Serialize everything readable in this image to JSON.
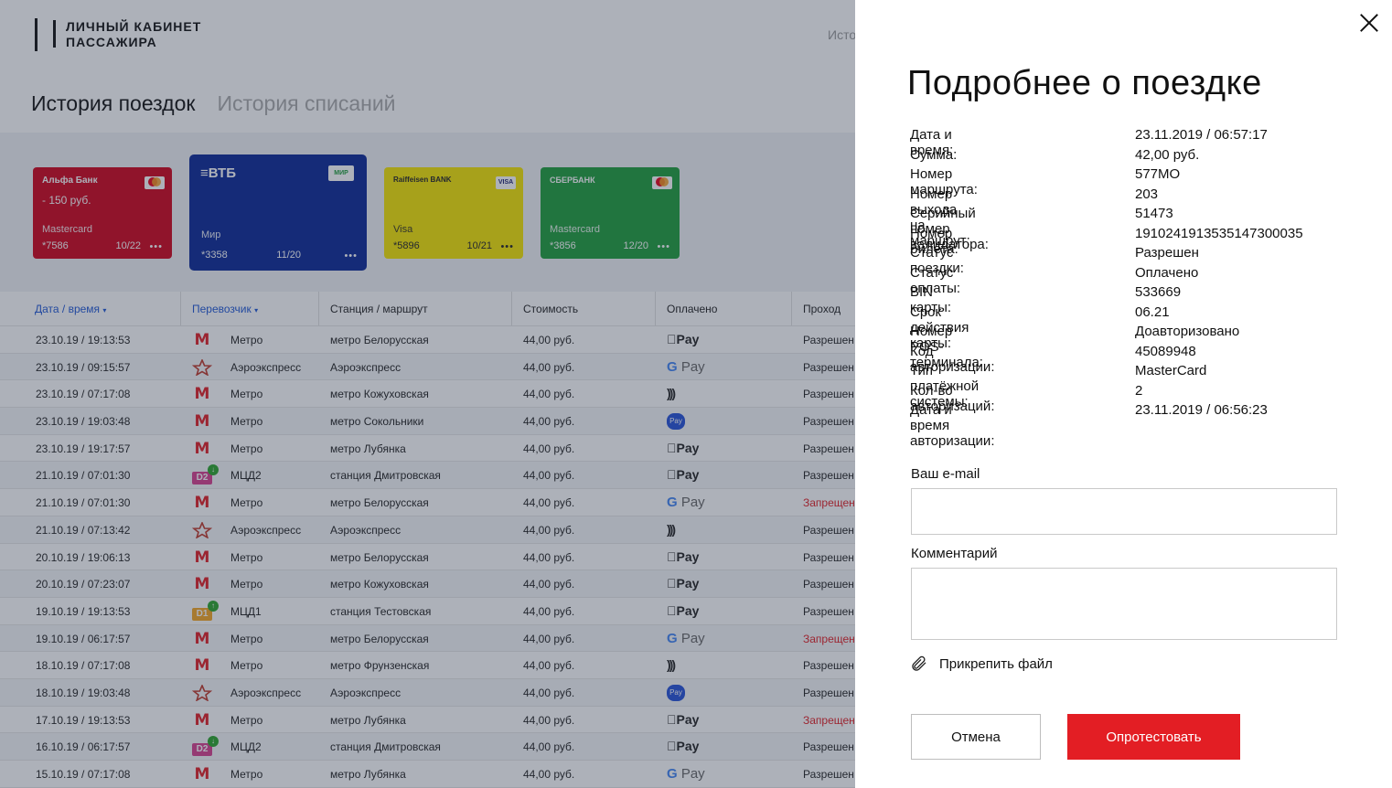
{
  "app": {
    "logo_line1": "ЛИЧНЫЙ КАБИНЕТ",
    "logo_line2": "ПАССАЖИРА",
    "nav_partial": "Исто"
  },
  "page_tabs": [
    {
      "label": "История поездок",
      "active": true
    },
    {
      "label": "История списаний",
      "active": false
    }
  ],
  "cards": [
    {
      "bank": "Альфа Банк",
      "badge": "MC",
      "amount": "- 150 руб.",
      "type": "Mastercard",
      "number": "*7586",
      "expiry": "10/22",
      "color": "#d0021b"
    },
    {
      "bank": "ВТБ",
      "badge": "МИР",
      "amount": "",
      "type": "Мир",
      "number": "*3358",
      "expiry": "11/20",
      "color": "#0a2896"
    },
    {
      "bank": "Raiffeisen BANK",
      "badge": "VISA",
      "amount": "",
      "type": "Visa",
      "number": "*5896",
      "expiry": "10/21",
      "color": "#f6e600"
    },
    {
      "bank": "СБЕРБАНК",
      "badge": "MC",
      "amount": "",
      "type": "Mastercard",
      "number": "*3856",
      "expiry": "12/20",
      "color": "#1e9e3a"
    }
  ],
  "table": {
    "headers": [
      "Дата / время",
      "Перевозчик",
      "Станция / маршрут",
      "Стоимость",
      "Оплачено",
      "Проход"
    ],
    "rows": [
      {
        "date": "23.10.19 / 19:13:53",
        "icon": "M",
        "carrier": "Метро",
        "station": "метро Белорусская",
        "price": "44,00 руб.",
        "paid": "Apple Pay",
        "pass": "Разрешен"
      },
      {
        "date": "23.10.19 / 09:15:57",
        "icon": "AE",
        "carrier": "Аэроэкспресс",
        "station": "Аэроэкспресс",
        "price": "44,00 руб.",
        "paid": "G Pay",
        "pass": "Разрешен"
      },
      {
        "date": "23.10.19 / 07:17:08",
        "icon": "M",
        "carrier": "Метро",
        "station": "метро Кожуховская",
        "price": "44,00 руб.",
        "paid": "contactless",
        "pass": "Разрешен"
      },
      {
        "date": "23.10.19 / 19:03:48",
        "icon": "M",
        "carrier": "Метро",
        "station": "метро Сокольники",
        "price": "44,00 руб.",
        "paid": "Pay",
        "pass": "Разрешен"
      },
      {
        "date": "23.10.19 / 19:17:57",
        "icon": "M",
        "carrier": "Метро",
        "station": "метро Лубянка",
        "price": "44,00 руб.",
        "paid": "Apple Pay",
        "pass": "Разрешен"
      },
      {
        "date": "21.10.19 / 07:01:30",
        "icon": "D2",
        "carrier": "МЦД2",
        "station": "станция Дмитровская",
        "price": "44,00 руб.",
        "paid": "Apple Pay",
        "pass": "Разрешен"
      },
      {
        "date": "21.10.19 / 07:01:30",
        "icon": "M",
        "carrier": "Метро",
        "station": "метро Белорусская",
        "price": "44,00 руб.",
        "paid": "G Pay",
        "pass": "Запрещен"
      },
      {
        "date": "21.10.19 / 07:13:42",
        "icon": "AE",
        "carrier": "Аэроэкспресс",
        "station": "Аэроэкспресс",
        "price": "44,00 руб.",
        "paid": "contactless",
        "pass": "Разрешен"
      },
      {
        "date": "20.10.19 / 19:06:13",
        "icon": "M",
        "carrier": "Метро",
        "station": "метро Белорусская",
        "price": "44,00 руб.",
        "paid": "Apple Pay",
        "pass": "Разрешен"
      },
      {
        "date": "20.10.19 / 07:23:07",
        "icon": "M",
        "carrier": "Метро",
        "station": "метро Кожуховская",
        "price": "44,00 руб.",
        "paid": "Apple Pay",
        "pass": "Разрешен"
      },
      {
        "date": "19.10.19 / 19:13:53",
        "icon": "D1",
        "carrier": "МЦД1",
        "station": "станция Тестовская",
        "price": "44,00 руб.",
        "paid": "Apple Pay",
        "pass": "Разрешен"
      },
      {
        "date": "19.10.19 / 06:17:57",
        "icon": "M",
        "carrier": "Метро",
        "station": "метро Белорусская",
        "price": "44,00 руб.",
        "paid": "G Pay",
        "pass": "Запрещен"
      },
      {
        "date": "18.10.19 / 07:17:08",
        "icon": "M",
        "carrier": "Метро",
        "station": "метро Фрунзенская",
        "price": "44,00 руб.",
        "paid": "contactless",
        "pass": "Разрешен"
      },
      {
        "date": "18.10.19 / 19:03:48",
        "icon": "AE",
        "carrier": "Аэроэкспресс",
        "station": "Аэроэкспресс",
        "price": "44,00 руб.",
        "paid": "Pay",
        "pass": "Разрешен"
      },
      {
        "date": "17.10.19 / 19:13:53",
        "icon": "M",
        "carrier": "Метро",
        "station": "метро Лубянка",
        "price": "44,00 руб.",
        "paid": "Apple Pay",
        "pass": "Запрещен"
      },
      {
        "date": "16.10.19 / 06:17:57",
        "icon": "D2",
        "carrier": "МЦД2",
        "station": "станция Дмитровская",
        "price": "44,00 руб.",
        "paid": "Apple Pay",
        "pass": "Разрешен"
      },
      {
        "date": "15.10.19 / 07:17:08",
        "icon": "M",
        "carrier": "Метро",
        "station": "метро Лубянка",
        "price": "44,00 руб.",
        "paid": "G Pay",
        "pass": "Разрешен"
      }
    ]
  },
  "panel": {
    "title": "Подробнее о поездке",
    "details": [
      {
        "label": "Дата и время:",
        "value": "23.11.2019 / 06:57:17"
      },
      {
        "label": "Сумма:",
        "value": "42,00  руб."
      },
      {
        "label": "Номер маршрута:",
        "value": "577МО"
      },
      {
        "label": "Номер выхода на маршрут:",
        "value": "203"
      },
      {
        "label": "Серийный номер валидатора:",
        "value": "51473"
      },
      {
        "label": "Номер билета:",
        "value": "1910241913535147300035"
      },
      {
        "label": "Статус поездки:",
        "value": "Разрешен"
      },
      {
        "label": "Статус оплаты:",
        "value": "Оплачено"
      },
      {
        "label": "BIN карты:",
        "value": "533669"
      },
      {
        "label": "Срок действия карты:",
        "value": "06.21"
      },
      {
        "label": "Номер POS-терминала:",
        "value": "Доавторизовано"
      },
      {
        "label": "Код авторизации:",
        "value": "45089948"
      },
      {
        "label": "Тип платёжной системы:",
        "value": "MasterCard"
      },
      {
        "label": "Кол-во авторизаций:",
        "value": "2"
      },
      {
        "label": "Дата и время авторизации:",
        "value": "23.11.2019 / 06:56:23"
      }
    ],
    "email_label": "Ваш e-mail",
    "email_value": "",
    "comment_label": "Комментарий",
    "comment_value": "",
    "attach_label": "Прикрепить файл",
    "cancel_label": "Отмена",
    "protest_label": "Опротестовать"
  },
  "colors": {
    "accent_red": "#e31e24",
    "link_blue": "#1f57d6",
    "mcd_orange": "#f5a623",
    "mcd_pink": "#d9408f",
    "check_green": "#2aa52a"
  }
}
